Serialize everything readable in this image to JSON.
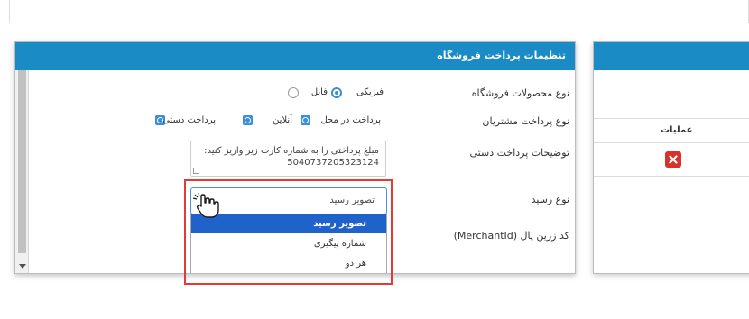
{
  "panel": {
    "title": "تنظیمات پرداخت فروشگاه",
    "fields": {
      "product_type_label": "نوع محصولات فروشگاه",
      "product_type_options": [
        "فیزیکی",
        "فایل"
      ],
      "payment_type_label": "نوع پرداخت مشتریان",
      "payment_type_options": [
        "پرداخت در محل",
        "آنلاین",
        "پرداخت دستی"
      ],
      "manual_desc_label": "توضیحات پرداخت دستی",
      "manual_desc_line1": "مبلغ پرداختی را به شماره کارت زیر واریز کنید:",
      "manual_desc_line2": "5040737205323124",
      "receipt_type_label": "نوع رسید",
      "receipt_type_value": "تصویر رسید",
      "receipt_type_options": [
        "تصویر رسید",
        "شماره پیگیری",
        "هر دو"
      ],
      "zarinpal_label": "کد زرین پال (MerchantId)"
    }
  },
  "right_panel": {
    "ops_header": "عملیات"
  },
  "colors": {
    "header_blue": "#1a8bc4",
    "selected_option": "#1f62c9",
    "highlight_border": "#e53935",
    "delete_red": "#d9322a"
  },
  "icons": [
    "hand-cursor-icon",
    "delete-icon",
    "radio-icon",
    "checkbox-icon"
  ]
}
